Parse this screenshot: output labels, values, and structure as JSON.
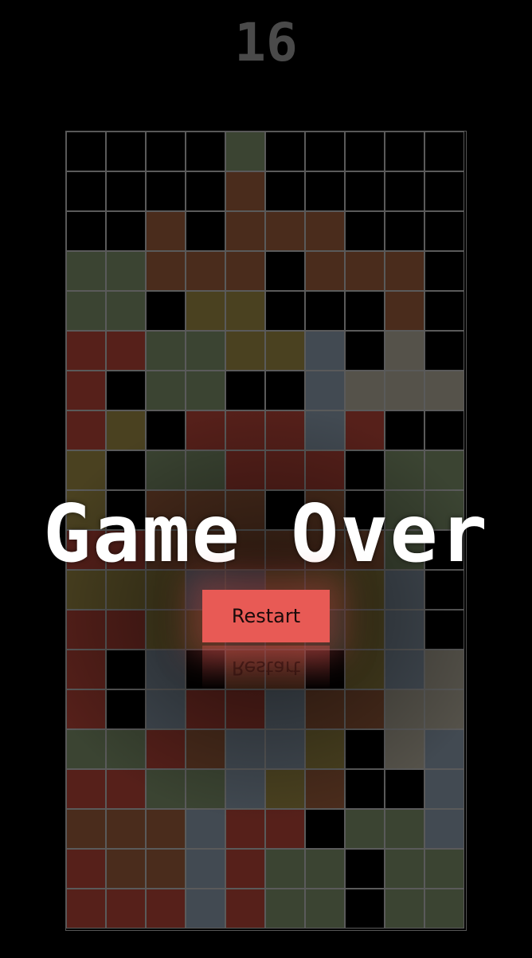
{
  "score": "16",
  "game_over_text": "Game Over",
  "restart_label": "Restart",
  "colors": {
    "empty": "#000000",
    "green": "#3b4432",
    "brown": "#4a2c1c",
    "red": "#56201a",
    "olive": "#4a4120",
    "slate": "#424a52",
    "gray": "#55524a",
    "button": "#e85a55"
  },
  "board": [
    [
      "e",
      "e",
      "e",
      "e",
      "g",
      "e",
      "e",
      "e",
      "e",
      "e"
    ],
    [
      "e",
      "e",
      "e",
      "e",
      "b",
      "e",
      "e",
      "e",
      "e",
      "e"
    ],
    [
      "e",
      "e",
      "b",
      "e",
      "b",
      "b",
      "b",
      "e",
      "e",
      "e"
    ],
    [
      "g",
      "g",
      "b",
      "b",
      "b",
      "e",
      "b",
      "b",
      "b",
      "e"
    ],
    [
      "g",
      "g",
      "e",
      "o",
      "o",
      "e",
      "e",
      "e",
      "b",
      "e"
    ],
    [
      "r",
      "r",
      "g",
      "g",
      "o",
      "o",
      "s",
      "e",
      "y",
      "e"
    ],
    [
      "r",
      "e",
      "g",
      "g",
      "e",
      "e",
      "s",
      "y",
      "y",
      "y"
    ],
    [
      "r",
      "o",
      "e",
      "r",
      "r",
      "r",
      "s",
      "r",
      "e",
      "e"
    ],
    [
      "o",
      "e",
      "g",
      "g",
      "r",
      "r",
      "r",
      "e",
      "g",
      "g"
    ],
    [
      "o",
      "e",
      "b",
      "b",
      "b",
      "e",
      "b",
      "e",
      "g",
      "g"
    ],
    [
      "r",
      "r",
      "b",
      "b",
      "b",
      "b",
      "b",
      "b",
      "g",
      "e"
    ],
    [
      "o",
      "o",
      "o",
      "s",
      "s",
      "o",
      "o",
      "o",
      "s",
      "e"
    ],
    [
      "r",
      "r",
      "o",
      "o",
      "g",
      "o",
      "g",
      "o",
      "s",
      "e"
    ],
    [
      "r",
      "e",
      "s",
      "e",
      "b",
      "b",
      "e",
      "o",
      "s",
      "y"
    ],
    [
      "r",
      "e",
      "s",
      "r",
      "r",
      "s",
      "b",
      "b",
      "y",
      "y"
    ],
    [
      "g",
      "g",
      "r",
      "b",
      "s",
      "s",
      "o",
      "e",
      "y",
      "s"
    ],
    [
      "r",
      "r",
      "g",
      "g",
      "s",
      "o",
      "b",
      "e",
      "e",
      "s"
    ],
    [
      "b",
      "b",
      "b",
      "s",
      "r",
      "r",
      "e",
      "g",
      "g",
      "s"
    ],
    [
      "r",
      "b",
      "b",
      "s",
      "r",
      "g",
      "g",
      "e",
      "g",
      "g"
    ],
    [
      "r",
      "r",
      "r",
      "s",
      "r",
      "g",
      "g",
      "e",
      "g",
      "g"
    ]
  ]
}
